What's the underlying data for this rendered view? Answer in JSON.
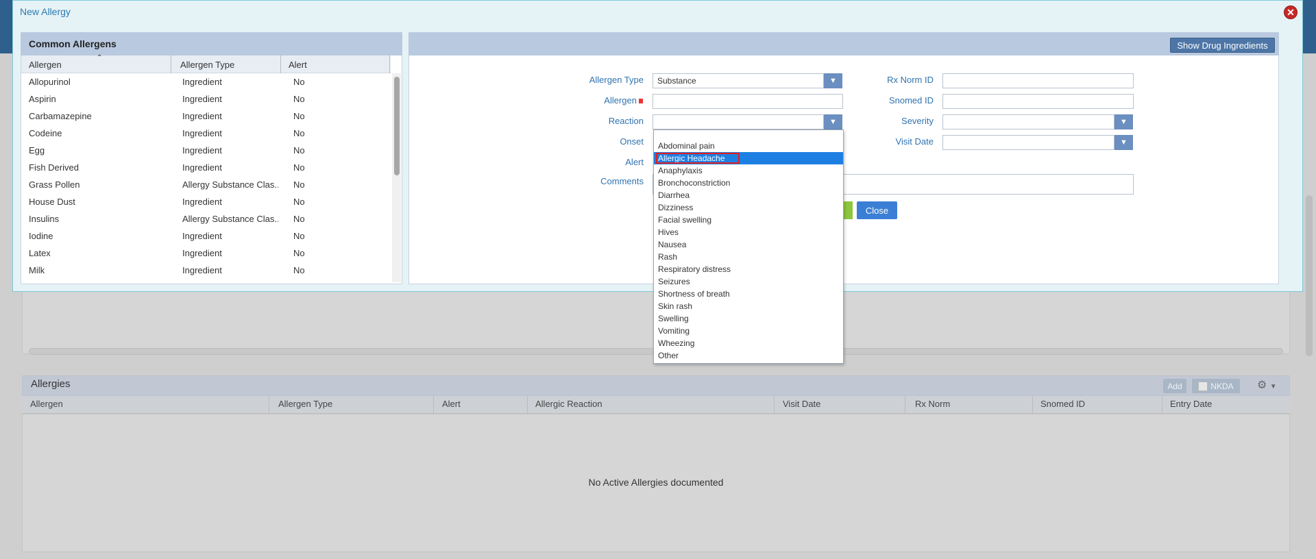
{
  "modal": {
    "title": "New Allergy",
    "close_icon": "close-x-circle-icon",
    "common_allergens": {
      "title": "Common Allergens",
      "columns": [
        "Allergen",
        "Allergen Type",
        "Alert"
      ],
      "rows": [
        [
          "Allopurinol",
          "Ingredient",
          "No"
        ],
        [
          "Aspirin",
          "Ingredient",
          "No"
        ],
        [
          "Carbamazepine",
          "Ingredient",
          "No"
        ],
        [
          "Codeine",
          "Ingredient",
          "No"
        ],
        [
          "Egg",
          "Ingredient",
          "No"
        ],
        [
          "Fish Derived",
          "Ingredient",
          "No"
        ],
        [
          "Grass Pollen",
          "Allergy Substance Clas...",
          "No"
        ],
        [
          "House Dust",
          "Ingredient",
          "No"
        ],
        [
          "Insulins",
          "Allergy Substance Clas...",
          "No"
        ],
        [
          "Iodine",
          "Ingredient",
          "No"
        ],
        [
          "Latex",
          "Ingredient",
          "No"
        ],
        [
          "Milk",
          "Ingredient",
          "No"
        ]
      ]
    },
    "form": {
      "show_drug_ingredients": "Show Drug Ingredients",
      "labels": {
        "allergen_type": "Allergen Type",
        "allergen": "Allergen",
        "reaction": "Reaction",
        "onset": "Onset",
        "alert": "Alert",
        "comments": "Comments",
        "rx_norm_id": "Rx Norm ID",
        "snomed_id": "Snomed ID",
        "severity": "Severity",
        "visit_date": "Visit Date"
      },
      "values": {
        "allergen_type": "Substance",
        "allergen": "",
        "reaction": "",
        "rx_norm_id": "",
        "snomed_id": "",
        "severity": "",
        "visit_date": "",
        "comments": ""
      },
      "close_button": "Close"
    },
    "reaction_options": [
      "Abdominal pain",
      "Allergic Headache",
      "Anaphylaxis",
      "Bronchoconstriction",
      "Diarrhea",
      "Dizziness",
      "Facial swelling",
      "Hives",
      "Nausea",
      "Rash",
      "Respiratory distress",
      "Seizures",
      "Shortness of breath",
      "Skin rash",
      "Swelling",
      "Vomiting",
      "Wheezing",
      "Other"
    ],
    "reaction_selected_index": 1
  },
  "allergies": {
    "title": "Allergies",
    "add_label": "Add",
    "nkda_label": "NKDA",
    "settings_icon": "gear-icon",
    "columns": [
      "Allergen",
      "Allergen Type",
      "Alert",
      "Allergic Reaction",
      "Visit Date",
      "Rx Norm",
      "Snomed ID",
      "Entry Date"
    ],
    "empty_message": "No Active Allergies documented"
  }
}
